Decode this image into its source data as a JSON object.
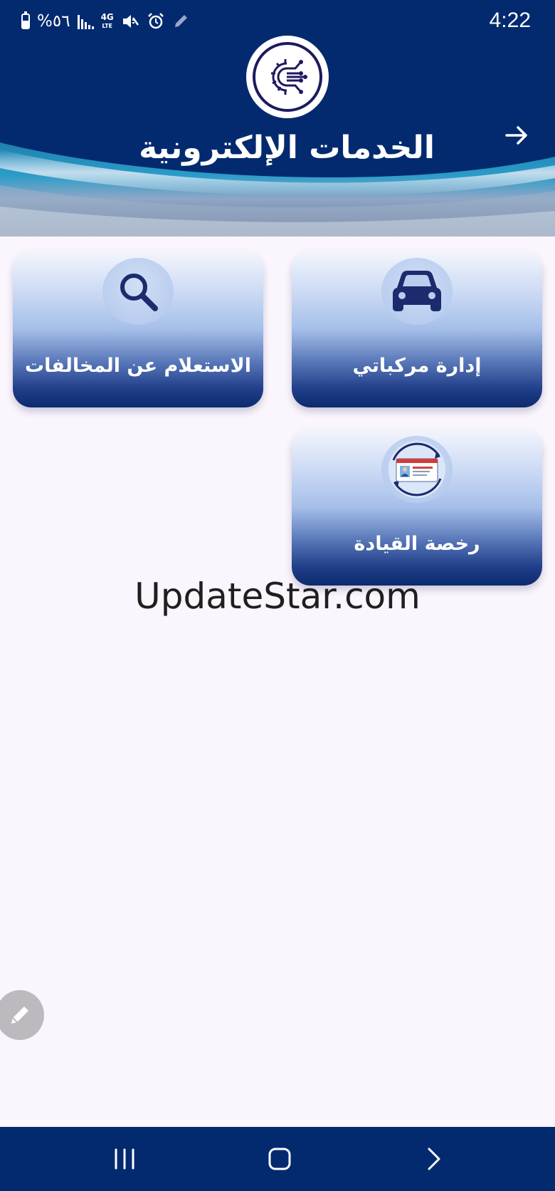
{
  "status_bar": {
    "battery_percent": "%٥٦",
    "network_type": "4G",
    "network_sub": "LTE",
    "time": "4:22"
  },
  "header": {
    "title": "الخدمات الإلكترونية",
    "logo_icon": "digital-gear-logo-icon",
    "nav_icon": "arrow-right-icon"
  },
  "tiles": [
    {
      "label": "إدارة مركباتي",
      "icon": "car-icon"
    },
    {
      "label": "الاستعلام عن المخالفات",
      "icon": "search-icon"
    },
    {
      "label": "رخصة القيادة",
      "icon": "driving-license-icon"
    }
  ],
  "watermark": "UpdateStar.com",
  "fab": {
    "icon": "pencil-icon"
  },
  "navigation": {
    "recents_icon": "recents-icon",
    "home_icon": "home-icon",
    "back_icon": "back-chevron-icon"
  },
  "colors": {
    "header_bg": "#032a6e",
    "tile_dark": "#0c2a6d",
    "tile_light": "#c6d6f3",
    "page_bg": "#fbf5fd",
    "icon_navy": "#1c2a6e"
  }
}
